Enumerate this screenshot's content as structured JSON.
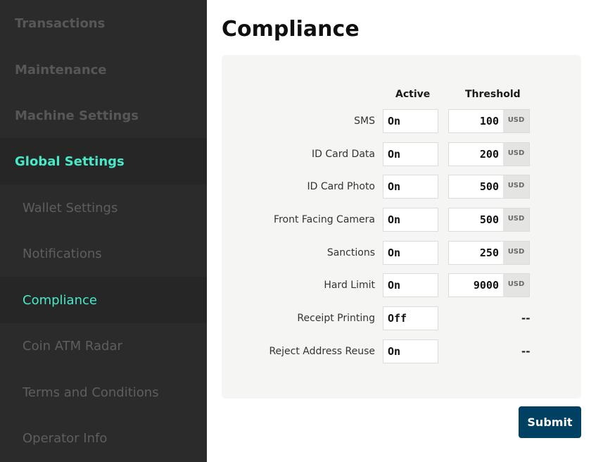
{
  "sidebar": {
    "items": [
      {
        "label": "Transactions"
      },
      {
        "label": "Maintenance"
      },
      {
        "label": "Machine Settings"
      },
      {
        "label": "Global Settings"
      }
    ],
    "subitems": [
      {
        "label": "Wallet Settings"
      },
      {
        "label": "Notifications"
      },
      {
        "label": "Compliance"
      },
      {
        "label": "Coin ATM Radar"
      },
      {
        "label": "Terms and Conditions"
      },
      {
        "label": "Operator Info"
      }
    ],
    "accent_color": "#48e9c9"
  },
  "main": {
    "title": "Compliance",
    "columns": {
      "active": "Active",
      "threshold": "Threshold"
    },
    "rows": [
      {
        "label": "SMS",
        "active": "On",
        "threshold": "100",
        "unit": "USD"
      },
      {
        "label": "ID Card Data",
        "active": "On",
        "threshold": "200",
        "unit": "USD"
      },
      {
        "label": "ID Card Photo",
        "active": "On",
        "threshold": "500",
        "unit": "USD"
      },
      {
        "label": "Front Facing Camera",
        "active": "On",
        "threshold": "500",
        "unit": "USD"
      },
      {
        "label": "Sanctions",
        "active": "On",
        "threshold": "250",
        "unit": "USD"
      },
      {
        "label": "Hard Limit",
        "active": "On",
        "threshold": "9000",
        "unit": "USD"
      },
      {
        "label": "Receipt Printing",
        "active": "Off",
        "threshold": "--"
      },
      {
        "label": "Reject Address Reuse",
        "active": "On",
        "threshold": "--"
      }
    ],
    "submit_label": "Submit",
    "submit_color": "#004062"
  }
}
